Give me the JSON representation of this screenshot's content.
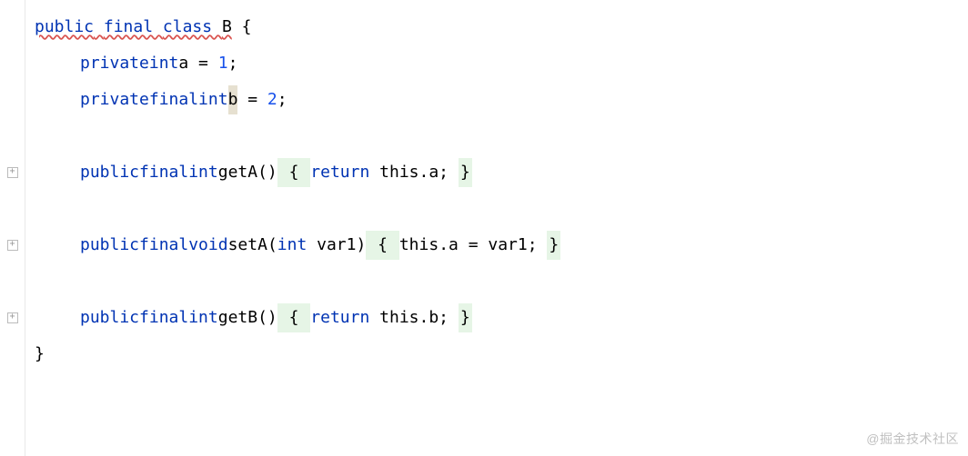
{
  "code": {
    "line1": {
      "kw_public": "public",
      "kw_final": "final",
      "kw_class": "class",
      "class_name": "B",
      "brace_open": " {"
    },
    "line2": {
      "kw_private": "private",
      "type_int": "int",
      "field_a": "a",
      "equals": " = ",
      "value": "1",
      "semi": ";"
    },
    "line3": {
      "kw_private": "private",
      "kw_final": "final",
      "type_int": "int",
      "field_b": "b",
      "equals": " = ",
      "value": "2",
      "semi": ";"
    },
    "line5": {
      "kw_public": "public",
      "kw_final": "final",
      "type_int": "int",
      "method": "getA",
      "params": "()",
      "body_open": " { ",
      "kw_return": "return",
      "expr": " this.a; ",
      "body_close": "}"
    },
    "line7": {
      "kw_public": "public",
      "kw_final": "final",
      "type_void": "void",
      "method": "setA",
      "params_open": "(",
      "type_int": "int",
      "param_name": " var1",
      "params_close": ")",
      "body_open": " { ",
      "expr": "this.a = var1; ",
      "body_close": "}"
    },
    "line9": {
      "kw_public": "public",
      "kw_final": "final",
      "type_int": "int",
      "method": "getB",
      "params": "()",
      "body_open": " { ",
      "kw_return": "return",
      "expr": " this.b; ",
      "body_close": "}"
    },
    "line10": {
      "brace_close": "}"
    }
  },
  "watermark": "@掘金技术社区"
}
